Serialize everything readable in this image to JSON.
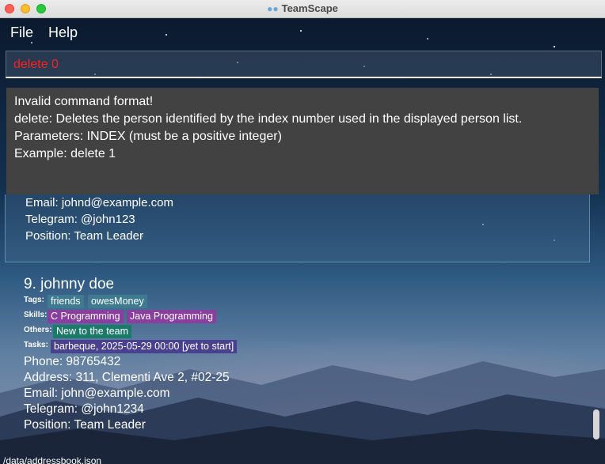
{
  "window": {
    "title": "TeamScape",
    "icon": "people-icon"
  },
  "menu": {
    "file": "File",
    "help": "Help"
  },
  "command": {
    "value": "delete 0",
    "color": "#ff2020"
  },
  "result": {
    "lines": [
      "Invalid command format!",
      "delete: Deletes the person identified by the index number used in the displayed person list.",
      "Parameters: INDEX (must be a positive integer)",
      "Example: delete 1"
    ]
  },
  "prev_card": {
    "email": "Email: johnd@example.com",
    "telegram": "Telegram: @john123",
    "position": "Position: Team Leader"
  },
  "card": {
    "name": "9. johnny doe",
    "labels": {
      "tags": "Tags:",
      "skills": "Skills:",
      "others": "Others:",
      "tasks": "Tasks:"
    },
    "tags": [
      "friends",
      "owesMoney"
    ],
    "skills": [
      "C Programming",
      "Java Programming"
    ],
    "others": [
      "New to the team"
    ],
    "tasks": [
      "barbeque, 2025-05-29 00:00 [yet to start]"
    ],
    "phone": "Phone: 98765432",
    "address": "Address: 311, Clementi Ave 2, #02-25",
    "email": "Email: john@example.com",
    "telegram": "Telegram: @john1234",
    "position": "Position: Team Leader"
  },
  "status": {
    "path": "/data/addressbook.json"
  }
}
